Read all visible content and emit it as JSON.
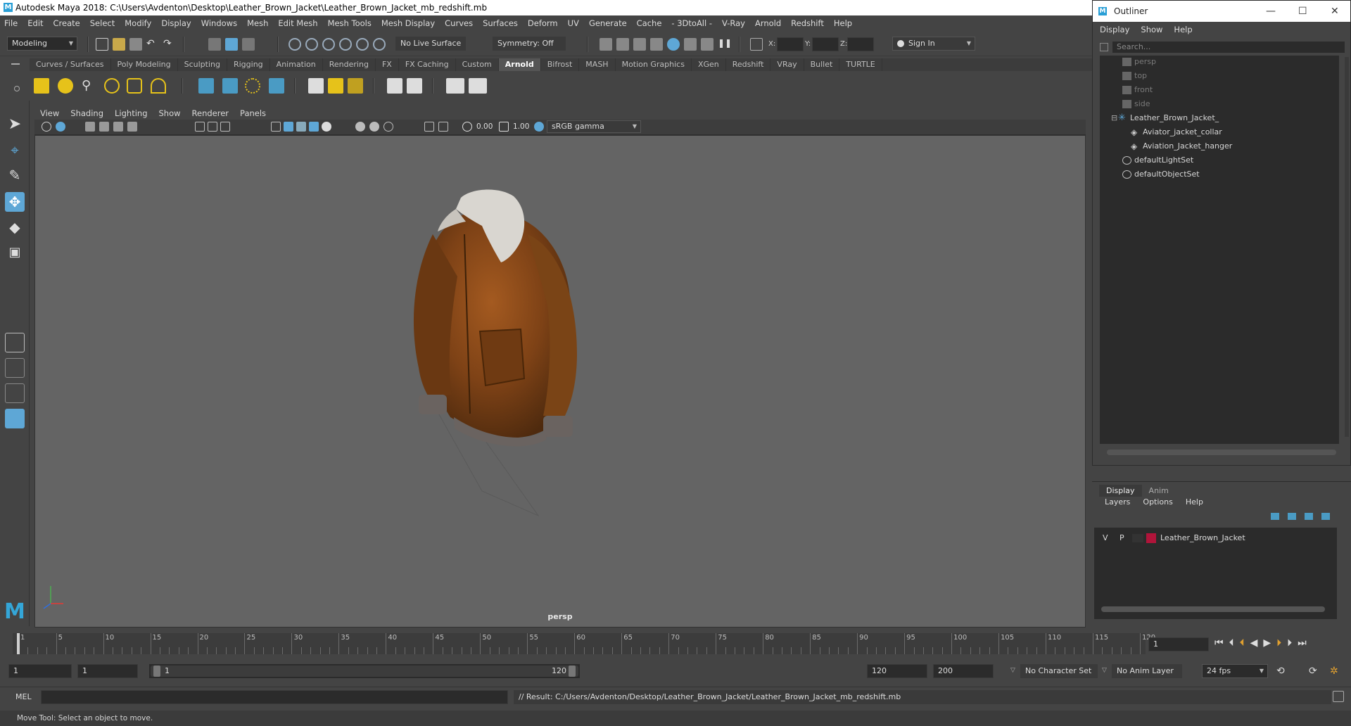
{
  "window": {
    "title": "Autodesk Maya 2018: C:\\Users\\Avdenton\\Desktop\\Leather_Brown_Jacket\\Leather_Brown_Jacket_mb_redshift.mb"
  },
  "menubar": [
    "File",
    "Edit",
    "Create",
    "Select",
    "Modify",
    "Display",
    "Windows",
    "Mesh",
    "Edit Mesh",
    "Mesh Tools",
    "Mesh Display",
    "Curves",
    "Surfaces",
    "Deform",
    "UV",
    "Generate",
    "Cache",
    "- 3DtoAll -",
    "V-Ray",
    "Arnold",
    "Redshift",
    "Help"
  ],
  "statusline": {
    "mode": "Modeling",
    "live_surface": "No Live Surface",
    "symmetry": "Symmetry: Off",
    "x_label": "X:",
    "y_label": "Y:",
    "z_label": "Z:",
    "sign_in": "Sign In"
  },
  "shelf_tabs": [
    "Curves / Surfaces",
    "Poly Modeling",
    "Sculpting",
    "Rigging",
    "Animation",
    "Rendering",
    "FX",
    "FX Caching",
    "Custom",
    "Arnold",
    "Bifrost",
    "MASH",
    "Motion Graphics",
    "XGen",
    "Redshift",
    "VRay",
    "Bullet",
    "TURTLE"
  ],
  "active_shelf_tab": "Arnold",
  "viewport": {
    "menu": [
      "View",
      "Shading",
      "Lighting",
      "Show",
      "Renderer",
      "Panels"
    ],
    "exposure": "0.00",
    "gamma": "1.00",
    "color_space": "sRGB gamma",
    "camera_label": "persp"
  },
  "outliner": {
    "title": "Outliner",
    "menu": [
      "Display",
      "Show",
      "Help"
    ],
    "search_placeholder": "Search...",
    "items": [
      {
        "label": "persp",
        "type": "camera",
        "dim": true
      },
      {
        "label": "top",
        "type": "camera",
        "dim": true
      },
      {
        "label": "front",
        "type": "camera",
        "dim": true
      },
      {
        "label": "side",
        "type": "camera",
        "dim": true
      },
      {
        "label": "Leather_Brown_Jacket_",
        "type": "group",
        "dim": false
      },
      {
        "label": "Aviator_jacket_collar",
        "type": "mesh",
        "dim": false
      },
      {
        "label": "Aviation_Jacket_hanger",
        "type": "mesh",
        "dim": false
      },
      {
        "label": "defaultLightSet",
        "type": "set",
        "dim": false
      },
      {
        "label": "defaultObjectSet",
        "type": "set",
        "dim": false
      }
    ]
  },
  "layer_editor": {
    "tabs": [
      "Display",
      "Anim"
    ],
    "menu": [
      "Layers",
      "Options",
      "Help"
    ],
    "layer": {
      "v": "V",
      "p": "P",
      "name": "Leather_Brown_Jacket",
      "color": "#b0143a"
    }
  },
  "timeline": {
    "ticks": [
      "1",
      "5",
      "10",
      "15",
      "20",
      "25",
      "30",
      "35",
      "40",
      "45",
      "50",
      "55",
      "60",
      "65",
      "70",
      "75",
      "80",
      "85",
      "90",
      "95",
      "100",
      "105",
      "110",
      "115",
      "120"
    ],
    "current_frame": "1"
  },
  "range": {
    "start": "1",
    "playback_start": "1",
    "slider_start": "1",
    "slider_end": "120",
    "playback_end": "120",
    "end": "200",
    "character_set": "No Character Set",
    "anim_layer": "No Anim Layer",
    "fps": "24 fps"
  },
  "command_line": {
    "lang": "MEL",
    "result": "// Result: C:/Users/Avdenton/Desktop/Leather_Brown_Jacket/Leather_Brown_Jacket_mb_redshift.mb"
  },
  "help_line": "Move Tool: Select an object to move.",
  "colors": {
    "accent": "#5ea7d6",
    "jacket": "#8a4a1a",
    "layer": "#b0143a"
  }
}
